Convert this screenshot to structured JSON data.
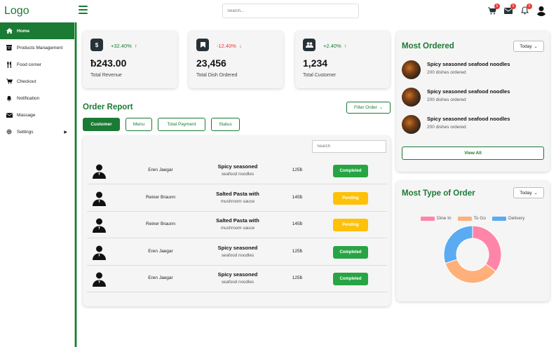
{
  "header": {
    "logo": "Logo",
    "search_placeholder": "Search...",
    "cart_badge": "5",
    "mail_badge": "5",
    "bell_badge": "5"
  },
  "sidebar": {
    "items": [
      {
        "label": "Home",
        "icon": "home-icon"
      },
      {
        "label": "Products Management",
        "icon": "box-icon"
      },
      {
        "label": "Food corner",
        "icon": "utensils-icon"
      },
      {
        "label": "Checkout",
        "icon": "cart-icon"
      },
      {
        "label": "Notification",
        "icon": "bell-icon"
      },
      {
        "label": "Massage",
        "icon": "mail-icon"
      },
      {
        "label": "Settings",
        "icon": "gear-icon"
      }
    ]
  },
  "stats": [
    {
      "change": "+32.40%",
      "arrow": "↑",
      "value": "ƀ243.00",
      "label": "Total Revenue",
      "icon": "dollar-icon"
    },
    {
      "change": "-12.40%",
      "arrow": "↓",
      "value": "23,456",
      "label": "Total Dish Ordered",
      "icon": "bookmark-icon"
    },
    {
      "change": "+2.40%",
      "arrow": "↑",
      "value": "1,234",
      "label": "Total Customer",
      "icon": "users-icon"
    }
  ],
  "order_report": {
    "title": "Order Report",
    "filter_label": "Filter Order",
    "tabs": [
      "Customer",
      "Menu",
      "Total Payment",
      "Status"
    ],
    "search_placeholder": "Search",
    "rows": [
      {
        "name": "Eren Jaegar",
        "dish1": "Spicy seasoned",
        "dish2": "seafood noodles",
        "price": "125ƀ",
        "status": "Completed"
      },
      {
        "name": "Reiner Braunn",
        "dish1": "Salted Pasta with",
        "dish2": "mushroom sauce",
        "price": "145ƀ",
        "status": "Pending"
      },
      {
        "name": "Reiner Braunn",
        "dish1": "Salted Pasta with",
        "dish2": "mushroom sauce",
        "price": "145ƀ",
        "status": "Pending"
      },
      {
        "name": "Eren Jaegar",
        "dish1": "Spicy seasoned",
        "dish2": "seafood noodles",
        "price": "125ƀ",
        "status": "Completed"
      },
      {
        "name": "Eren Jaegar",
        "dish1": "Spicy seasoned",
        "dish2": "seafood noodles",
        "price": "125ƀ",
        "status": "Completed"
      }
    ]
  },
  "most_ordered": {
    "title": "Most Ordered",
    "period": "Today",
    "items": [
      {
        "name": "Spicy seasoned seafood noodles",
        "sub": "200 dishes ordered"
      },
      {
        "name": "Spicy seasoned seafood noodles",
        "sub": "200 dishes ordered"
      },
      {
        "name": "Spicy seasoned seafood noodles",
        "sub": "200 dishes ordered"
      }
    ],
    "view_all": "View All"
  },
  "most_type": {
    "title": "Most Type of Order",
    "period": "Today",
    "legend": [
      "Dine In",
      "To Go",
      "Delivery"
    ]
  },
  "chart_data": {
    "type": "pie",
    "categories": [
      "Dine In",
      "To Go",
      "Delivery"
    ],
    "values": [
      35,
      35,
      30
    ],
    "colors": [
      "#ff85a8",
      "#ffb07a",
      "#5aabf2"
    ],
    "donut": true,
    "legend_position": "top"
  },
  "colors": {
    "brand": "#1b7a34",
    "completed": "#27a444",
    "pending": "#ffc107"
  }
}
